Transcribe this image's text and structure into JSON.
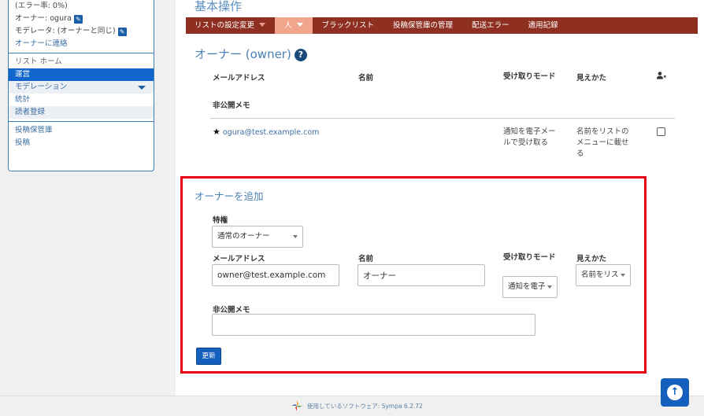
{
  "sidebar": {
    "error_rate": "(エラー率: 0%)",
    "owner_line": "オーナー: ogura",
    "moderator_line": "モデレータ: (オーナーと同じ)",
    "contact_owner": "オーナーに連絡",
    "list_home": "リスト ホーム",
    "admin": "運営",
    "moderation": "モデレーション",
    "stats": "統計",
    "subscribers": "読者登録",
    "archive_admin": "投稿保管庫",
    "post": "投稿"
  },
  "page": {
    "title": "基本操作"
  },
  "menu": {
    "items": [
      "リストの設定変更",
      "人",
      "ブラックリスト",
      "投稿保管庫の管理",
      "配送エラー",
      "適用記録"
    ]
  },
  "owners": {
    "section_title": "オーナー (owner)",
    "col_email": "メールアドレス",
    "col_name": "名前",
    "col_reception": "受け取りモード",
    "col_visibility": "見えかた",
    "col_memo": "非公開メモ",
    "rows": [
      {
        "email": "ogura@test.example.com",
        "name": "",
        "reception": "通知を電子メールで受け取る",
        "visibility": "名前をリストのメニューに載せる"
      }
    ]
  },
  "add_owner": {
    "title": "オーナーを追加",
    "privilege_label": "特権",
    "privilege_value": "通常のオーナー",
    "email_label": "メールアドレス",
    "email_value": "owner@test.example.com",
    "name_label": "名前",
    "name_value": "オーナー",
    "reception_label": "受け取りモード",
    "reception_value": "通知を電子",
    "visibility_label": "見えかた",
    "visibility_value": "名前をリス",
    "memo_label": "非公開メモ",
    "memo_value": "",
    "update_button": "更新"
  },
  "footer": {
    "text": "使用しているソフトウェア: Sympa 6.2.72"
  },
  "colors": {
    "menu_bar": "#8e2f22",
    "menu_active": "#f2a58d",
    "primary_blue": "#1560bd",
    "highlight_red": "#e60012"
  },
  "icons": [
    "pencil-icon",
    "chevron-down-icon",
    "help-icon",
    "star-icon",
    "user-remove-icon",
    "arrow-up-icon",
    "sympa-logo-icon"
  ]
}
